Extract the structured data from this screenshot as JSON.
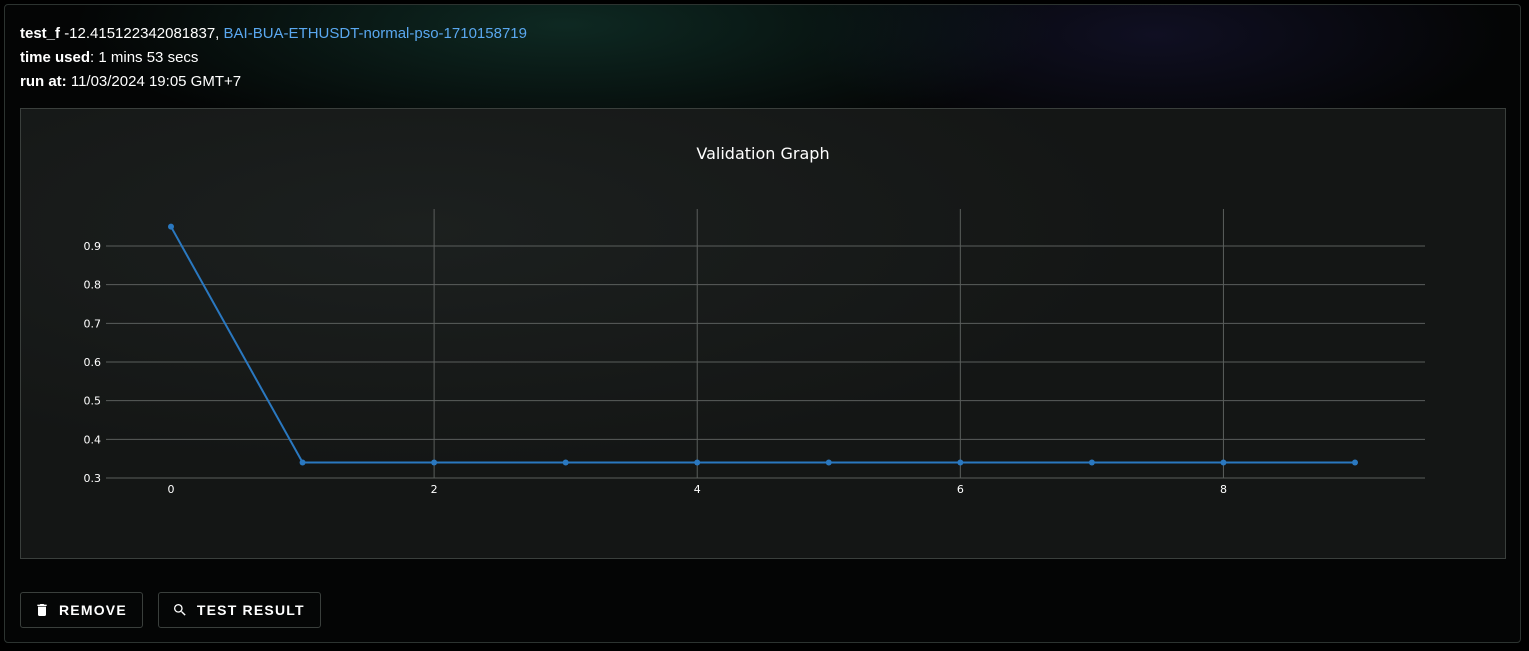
{
  "header": {
    "metric_label": "test_f",
    "metric_value": "-12.415122342081837,",
    "run_name": "BAI-BUA-ETHUSDT-normal-pso-1710158719",
    "time_used_label": "time used",
    "time_used_value": ": 1 mins 53 secs",
    "run_at_label": "run at:",
    "run_at_value": " 11/03/2024 19:05 GMT+7"
  },
  "actions": {
    "remove_label": "REMOVE",
    "test_result_label": "TEST RESULT"
  },
  "colors": {
    "line": "#2a78c0",
    "grid": "#5a5e5c",
    "text": "#ffffff"
  },
  "chart_data": {
    "type": "line",
    "title": "Validation Graph",
    "x": [
      0,
      1,
      2,
      3,
      4,
      5,
      6,
      7,
      8,
      9
    ],
    "series": [
      {
        "values": [
          0.95,
          0.34,
          0.34,
          0.34,
          0.34,
          0.34,
          0.34,
          0.34,
          0.34,
          0.34
        ]
      }
    ],
    "xlim": [
      0,
      9
    ],
    "ylim": [
      0.3,
      0.95
    ],
    "xticks": [
      0,
      2,
      4,
      6,
      8
    ],
    "yticks": [
      0.3,
      0.4,
      0.5,
      0.6,
      0.7,
      0.8,
      0.9
    ],
    "grid": true,
    "markers": true
  }
}
